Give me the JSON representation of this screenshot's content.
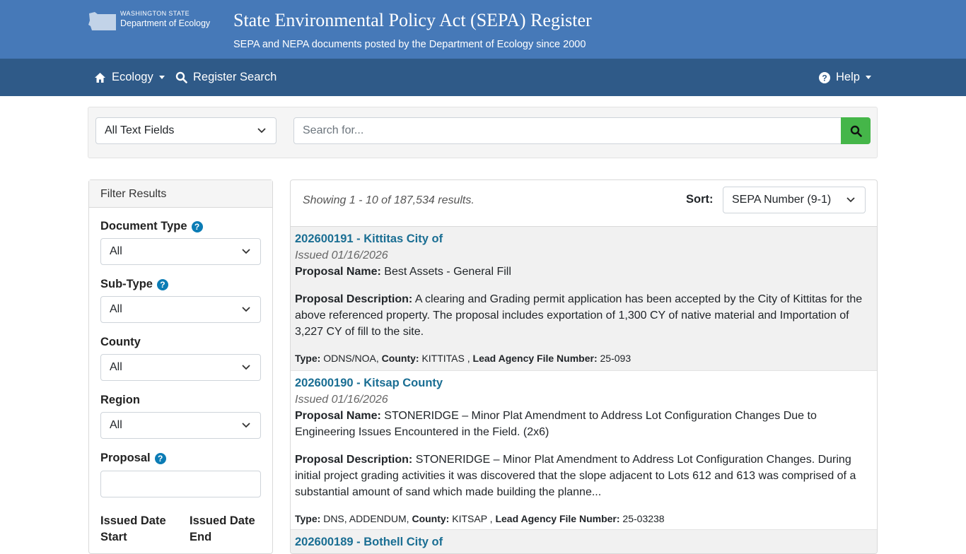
{
  "header": {
    "logo_line1": "WASHINGTON STATE",
    "logo_line2": "Department of Ecology",
    "title": "State Environmental Policy Act (SEPA) Register",
    "subtitle": "SEPA and NEPA documents posted by the Department of Ecology since 2000"
  },
  "nav": {
    "ecology": "Ecology",
    "register_search": "Register Search",
    "help": "Help"
  },
  "search": {
    "field_select": "All Text Fields",
    "placeholder": "Search for..."
  },
  "filter": {
    "heading": "Filter Results",
    "document_type_label": "Document Type",
    "document_type_value": "All",
    "subtype_label": "Sub-Type",
    "subtype_value": "All",
    "county_label": "County",
    "county_value": "All",
    "region_label": "Region",
    "region_value": "All",
    "proposal_label": "Proposal",
    "proposal_value": "",
    "issued_start_label_1": "Issued Date",
    "issued_start_label_2": "Start",
    "issued_end_label_1": "Issued Date",
    "issued_end_label_2": "End"
  },
  "results": {
    "showing": "Showing 1 - 10 of 187,534 results.",
    "sort_label": "Sort:",
    "sort_value": "SEPA Number (9-1)",
    "records": [
      {
        "title": "202600191 - Kittitas City of",
        "issued": "Issued 01/16/2026",
        "proposal_name_label": "Proposal Name:",
        "proposal_name": "Best Assets - General Fill",
        "description_label": "Proposal Description:",
        "description": "A clearing and Grading permit application has been accepted by the City of Kittitas for the above referenced property. The proposal includes exportation of 1,300 CY of native material and Importation of 3,227 CY of fill to the site.",
        "type_label": "Type:",
        "type": "ODNS/NOA,",
        "county_label": "County:",
        "county": "KITTITAS ,",
        "file_label": "Lead Agency File Number:",
        "file": "25-093"
      },
      {
        "title": "202600190 - Kitsap County",
        "issued": "Issued 01/16/2026",
        "proposal_name_label": "Proposal Name:",
        "proposal_name": "STONERIDGE – Minor Plat Amendment to Address Lot Configuration Changes Due to Engineering Issues Encountered in the Field. (2x6)",
        "description_label": "Proposal Description:",
        "description": "STONERIDGE – Minor Plat Amendment to Address Lot Configuration Changes. During initial project grading activities it was discovered that the slope adjacent to Lots 612 and 613 was comprised of a substantial amount of sand which made building the planne...",
        "type_label": "Type:",
        "type": "DNS, ADDENDUM,",
        "county_label": "County:",
        "county": "KITSAP ,",
        "file_label": "Lead Agency File Number:",
        "file": "25-03238"
      },
      {
        "title": "202600189 - Bothell City of"
      }
    ]
  },
  "colors": {
    "banner": "#4679b8",
    "nav": "#2f5a88",
    "search_button": "#45b649",
    "link": "#1a6e93"
  }
}
